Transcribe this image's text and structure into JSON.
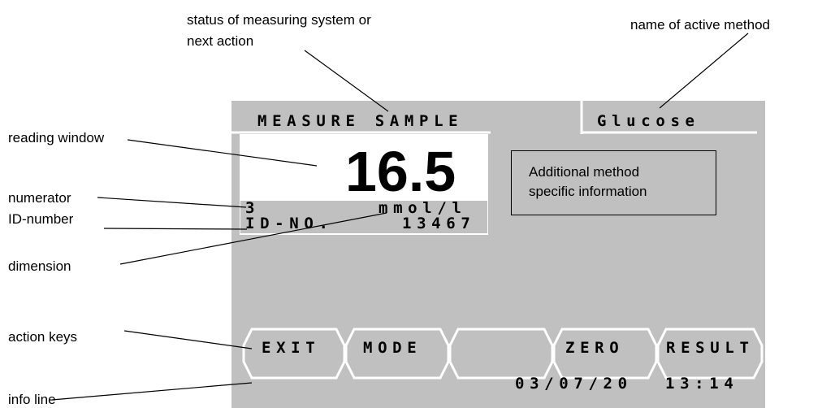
{
  "annotations": {
    "status_line1": "status of measuring system or",
    "status_line2": "next action",
    "method_name": "name of active method",
    "reading_window": "reading window",
    "numerator": "numerator",
    "id_number": "ID-number",
    "dimension": "dimension",
    "action_keys": "action keys",
    "info_line": "info line"
  },
  "display": {
    "status": "MEASURE SAMPLE",
    "method": "Glucose",
    "reading": "16.5",
    "numerator": "3",
    "unit": "mmol/l",
    "id_label": "ID-NO.",
    "id_value": "13467",
    "info_box_line1": "Additional method",
    "info_box_line2": "specific information",
    "keys": [
      "EXIT",
      "MODE",
      "",
      "ZERO",
      "RESULT"
    ],
    "date": "03/07/20",
    "time": "13:14"
  },
  "colors": {
    "screen_background": "#c0c0c0",
    "panel_white": "#ffffff",
    "text": "#000000"
  }
}
